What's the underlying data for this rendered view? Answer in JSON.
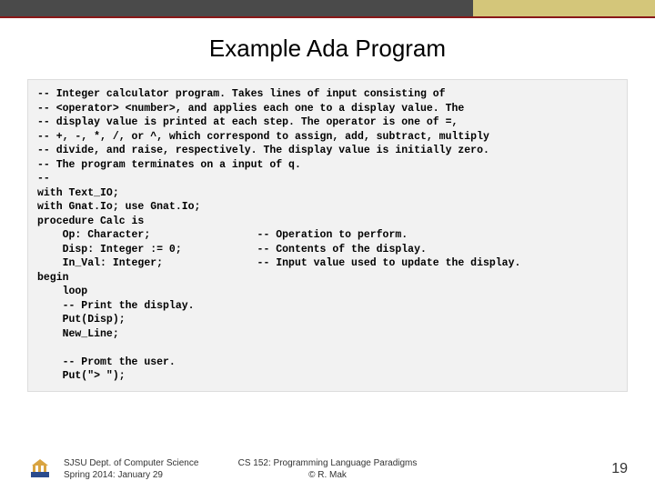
{
  "title": "Example Ada Program",
  "code": "-- Integer calculator program. Takes lines of input consisting of\n-- <operator> <number>, and applies each one to a display value. The\n-- display value is printed at each step. The operator is one of =,\n-- +, -, *, /, or ^, which correspond to assign, add, subtract, multiply\n-- divide, and raise, respectively. The display value is initially zero.\n-- The program terminates on a input of q.\n--\nwith Text_IO;\nwith Gnat.Io; use Gnat.Io;\nprocedure Calc is\n    Op: Character;                 -- Operation to perform.\n    Disp: Integer := 0;            -- Contents of the display.\n    In_Val: Integer;               -- Input value used to update the display.\nbegin\n    loop\n    -- Print the display.\n    Put(Disp);\n    New_Line;\n\n    -- Promt the user.\n    Put(\"> \");",
  "footer": {
    "dept_line1": "SJSU Dept. of Computer Science",
    "dept_line2": "Spring 2014: January 29",
    "course_line1": "CS 152: Programming Language Paradigms",
    "course_line2": "© R. Mak",
    "page": "19"
  }
}
